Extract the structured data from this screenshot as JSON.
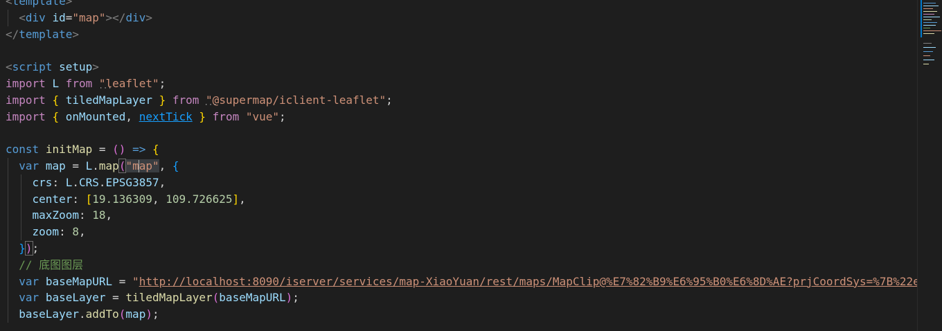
{
  "editor": {
    "lines": [
      {
        "id": "template-open",
        "tokens": [
          {
            "t": "<",
            "c": "g"
          },
          {
            "t": "template",
            "c": "k"
          },
          {
            "t": ">",
            "c": "g"
          }
        ]
      },
      {
        "id": "div-map",
        "indent": 1,
        "tokens": [
          {
            "t": "<",
            "c": "g"
          },
          {
            "t": "div",
            "c": "k"
          },
          {
            "t": " ",
            "c": "p"
          },
          {
            "t": "id",
            "c": "v"
          },
          {
            "t": "=",
            "c": "p"
          },
          {
            "t": "\"map\"",
            "c": "s"
          },
          {
            "t": "></",
            "c": "g"
          },
          {
            "t": "div",
            "c": "k"
          },
          {
            "t": ">",
            "c": "g"
          }
        ]
      },
      {
        "id": "template-close",
        "tokens": [
          {
            "t": "</",
            "c": "g"
          },
          {
            "t": "template",
            "c": "k"
          },
          {
            "t": ">",
            "c": "g"
          }
        ]
      },
      {
        "id": "blank-1",
        "tokens": []
      },
      {
        "id": "script-open",
        "tokens": [
          {
            "t": "<",
            "c": "g"
          },
          {
            "t": "script",
            "c": "k"
          },
          {
            "t": " ",
            "c": "p"
          },
          {
            "t": "setup",
            "c": "v"
          },
          {
            "t": ">",
            "c": "g"
          }
        ]
      },
      {
        "id": "import-leaflet",
        "tokens": [
          {
            "t": "import",
            "c": "c"
          },
          {
            "t": " ",
            "c": "p"
          },
          {
            "t": "L",
            "c": "v"
          },
          {
            "t": " ",
            "c": "p"
          },
          {
            "t": "from",
            "c": "c"
          },
          {
            "t": " ",
            "c": "p"
          },
          {
            "t": "\"leaflet\"",
            "c": "s"
          },
          {
            "t": ";",
            "c": "p"
          }
        ]
      },
      {
        "id": "import-iclient",
        "tokens": [
          {
            "t": "import",
            "c": "c"
          },
          {
            "t": " ",
            "c": "p"
          },
          {
            "t": "{",
            "c": "y"
          },
          {
            "t": " ",
            "c": "p"
          },
          {
            "t": "tiledMapLayer",
            "c": "v"
          },
          {
            "t": " ",
            "c": "p"
          },
          {
            "t": "}",
            "c": "y"
          },
          {
            "t": " ",
            "c": "p"
          },
          {
            "t": "from",
            "c": "c"
          },
          {
            "t": " ",
            "c": "p"
          },
          {
            "t": "\"@supermap/iclient-leaflet\"",
            "c": "s"
          },
          {
            "t": ";",
            "c": "p"
          }
        ]
      },
      {
        "id": "import-vue",
        "tokens": [
          {
            "t": "import",
            "c": "c"
          },
          {
            "t": " ",
            "c": "p"
          },
          {
            "t": "{",
            "c": "y"
          },
          {
            "t": " ",
            "c": "p"
          },
          {
            "t": "onMounted",
            "c": "v"
          },
          {
            "t": ", ",
            "c": "p"
          },
          {
            "t": "nextTick",
            "c": "b ul"
          },
          {
            "t": " ",
            "c": "p"
          },
          {
            "t": "}",
            "c": "y"
          },
          {
            "t": " ",
            "c": "p"
          },
          {
            "t": "from",
            "c": "c"
          },
          {
            "t": " ",
            "c": "p"
          },
          {
            "t": "\"vue\"",
            "c": "s"
          },
          {
            "t": ";",
            "c": "p"
          }
        ]
      },
      {
        "id": "blank-2",
        "tokens": []
      },
      {
        "id": "const-initmap",
        "tokens": [
          {
            "t": "const",
            "c": "k"
          },
          {
            "t": " ",
            "c": "p"
          },
          {
            "t": "initMap",
            "c": "f"
          },
          {
            "t": " = ",
            "c": "p"
          },
          {
            "t": "()",
            "c": "m"
          },
          {
            "t": " ",
            "c": "p"
          },
          {
            "t": "=>",
            "c": "k"
          },
          {
            "t": " ",
            "c": "p"
          },
          {
            "t": "{",
            "c": "y"
          }
        ]
      },
      {
        "id": "var-map",
        "indent": 1,
        "tokens": [
          {
            "t": "var",
            "c": "k"
          },
          {
            "t": " ",
            "c": "p"
          },
          {
            "t": "map",
            "c": "v"
          },
          {
            "t": " = ",
            "c": "p"
          },
          {
            "t": "L",
            "c": "v"
          },
          {
            "t": ".",
            "c": "p"
          },
          {
            "t": "map",
            "c": "f"
          },
          {
            "t": "(",
            "c": "m bracket-box"
          },
          {
            "t": "\"m",
            "c": "s hl"
          },
          {
            "t": "|",
            "c": "caret"
          },
          {
            "t": "ap\"",
            "c": "s hl"
          },
          {
            "t": ", ",
            "c": "p"
          },
          {
            "t": "{",
            "c": "b"
          }
        ]
      },
      {
        "id": "crs",
        "indent": 2,
        "tokens": [
          {
            "t": "crs",
            "c": "v"
          },
          {
            "t": ": ",
            "c": "p"
          },
          {
            "t": "L",
            "c": "v"
          },
          {
            "t": ".",
            "c": "p"
          },
          {
            "t": "CRS",
            "c": "v"
          },
          {
            "t": ".",
            "c": "p"
          },
          {
            "t": "EPSG3857",
            "c": "v"
          },
          {
            "t": ",",
            "c": "p"
          }
        ]
      },
      {
        "id": "center",
        "indent": 2,
        "tokens": [
          {
            "t": "center",
            "c": "v"
          },
          {
            "t": ": ",
            "c": "p"
          },
          {
            "t": "[",
            "c": "y"
          },
          {
            "t": "19.136309",
            "c": "n"
          },
          {
            "t": ", ",
            "c": "p"
          },
          {
            "t": "109.726625",
            "c": "n"
          },
          {
            "t": "]",
            "c": "y"
          },
          {
            "t": ",",
            "c": "p"
          }
        ]
      },
      {
        "id": "maxzoom",
        "indent": 2,
        "tokens": [
          {
            "t": "maxZoom",
            "c": "v"
          },
          {
            "t": ": ",
            "c": "p"
          },
          {
            "t": "18",
            "c": "n"
          },
          {
            "t": ",",
            "c": "p"
          }
        ]
      },
      {
        "id": "zoom",
        "indent": 2,
        "tokens": [
          {
            "t": "zoom",
            "c": "v"
          },
          {
            "t": ": ",
            "c": "p"
          },
          {
            "t": "8",
            "c": "n"
          },
          {
            "t": ",",
            "c": "p"
          }
        ]
      },
      {
        "id": "close-map",
        "indent": 1,
        "tokens": [
          {
            "t": "}",
            "c": "b"
          },
          {
            "t": ")",
            "c": "m bracket-box"
          },
          {
            "t": ";",
            "c": "p"
          }
        ]
      },
      {
        "id": "comment",
        "indent": 1,
        "tokens": [
          {
            "t": "// 底图图层",
            "c": "cm"
          }
        ]
      },
      {
        "id": "var-basemapurl",
        "indent": 1,
        "tokens": [
          {
            "t": "var",
            "c": "k"
          },
          {
            "t": " ",
            "c": "p"
          },
          {
            "t": "baseMapURL",
            "c": "v"
          },
          {
            "t": " = ",
            "c": "p"
          },
          {
            "t": "\"",
            "c": "s"
          },
          {
            "t": "http://localhost:8090/iserver/services/map-XiaoYuan/rest/maps/MapClip@%E7%82%B9%E6%95%B0%E6%8D%AE?prjCoordSys=%7B%22e",
            "c": "s url"
          }
        ]
      },
      {
        "id": "var-baselayer",
        "indent": 1,
        "tokens": [
          {
            "t": "var",
            "c": "k"
          },
          {
            "t": " ",
            "c": "p"
          },
          {
            "t": "baseLayer",
            "c": "v"
          },
          {
            "t": " = ",
            "c": "p"
          },
          {
            "t": "tiledMapLayer",
            "c": "f"
          },
          {
            "t": "(",
            "c": "m"
          },
          {
            "t": "baseMapURL",
            "c": "v"
          },
          {
            "t": ")",
            "c": "m"
          },
          {
            "t": ";",
            "c": "p"
          }
        ]
      },
      {
        "id": "addto",
        "indent": 1,
        "tokens": [
          {
            "t": "baseLayer",
            "c": "v"
          },
          {
            "t": ".",
            "c": "p"
          },
          {
            "t": "addTo",
            "c": "f"
          },
          {
            "t": "(",
            "c": "m"
          },
          {
            "t": "map",
            "c": "v"
          },
          {
            "t": ")",
            "c": "m"
          },
          {
            "t": ";",
            "c": "p"
          }
        ]
      }
    ]
  },
  "colors": {
    "background": "#1e1e1e",
    "keyword": "#569cd6",
    "control": "#c586c0",
    "string": "#ce9178",
    "number": "#b5cea8",
    "variable": "#9cdcfe",
    "function": "#dcdcaa",
    "comment": "#6a9955"
  }
}
